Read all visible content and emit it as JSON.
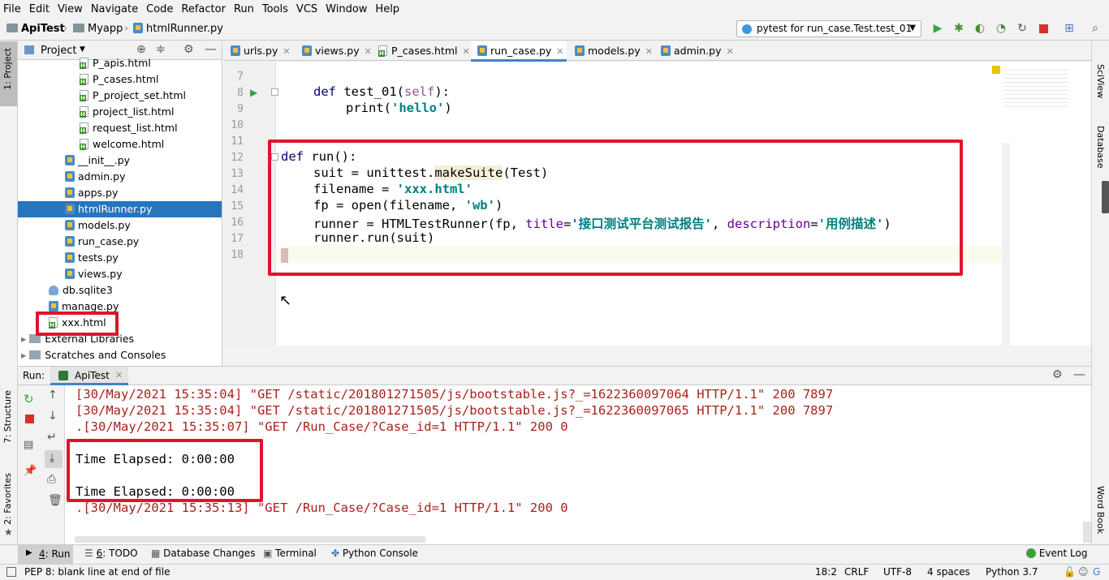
{
  "menu": [
    "File",
    "Edit",
    "View",
    "Navigate",
    "Code",
    "Refactor",
    "Run",
    "Tools",
    "VCS",
    "Window",
    "Help"
  ],
  "breadcrumb": {
    "project": "ApiTest",
    "folder": "Myapp",
    "file": "htmlRunner.py"
  },
  "run_config": "pytest for run_case.Test.test_01",
  "project_panel": {
    "title": "Project",
    "items": [
      {
        "label": "P_apis.html",
        "type": "html",
        "indent": 2
      },
      {
        "label": "P_cases.html",
        "type": "html",
        "indent": 2
      },
      {
        "label": "P_project_set.html",
        "type": "html",
        "indent": 2
      },
      {
        "label": "project_list.html",
        "type": "html",
        "indent": 2
      },
      {
        "label": "request_list.html",
        "type": "html",
        "indent": 2
      },
      {
        "label": "welcome.html",
        "type": "html",
        "indent": 2
      },
      {
        "label": "__init__.py",
        "type": "py",
        "indent": 1
      },
      {
        "label": "admin.py",
        "type": "py",
        "indent": 1
      },
      {
        "label": "apps.py",
        "type": "py",
        "indent": 1
      },
      {
        "label": "htmlRunner.py",
        "type": "py",
        "indent": 1,
        "selected": true
      },
      {
        "label": "models.py",
        "type": "py",
        "indent": 1
      },
      {
        "label": "run_case.py",
        "type": "py",
        "indent": 1
      },
      {
        "label": "tests.py",
        "type": "py",
        "indent": 1
      },
      {
        "label": "views.py",
        "type": "py",
        "indent": 1
      },
      {
        "label": "db.sqlite3",
        "type": "db",
        "indent": 0
      },
      {
        "label": "manage.py",
        "type": "py",
        "indent": 0
      },
      {
        "label": "xxx.html",
        "type": "html",
        "indent": 0
      },
      {
        "label": "External Libraries",
        "type": "lib",
        "indent": -1
      },
      {
        "label": "Scratches and Consoles",
        "type": "lib",
        "indent": -1
      }
    ]
  },
  "tabs": [
    {
      "label": "urls.py"
    },
    {
      "label": "views.py"
    },
    {
      "label": "P_cases.html"
    },
    {
      "label": "run_case.py",
      "active": true
    },
    {
      "label": "models.py"
    },
    {
      "label": "admin.py"
    }
  ],
  "editor": {
    "line_numbers": [
      "7",
      "8",
      "9",
      "10",
      "11",
      "12",
      "13",
      "14",
      "15",
      "16",
      "17",
      "18"
    ],
    "code": {
      "l8_def": "def ",
      "l8_name": "test_01(",
      "l8_self": "self",
      "l8_end": "):",
      "l9_print": "print(",
      "l9_str": "'hello'",
      "l9_end": ")",
      "l12_def": "def ",
      "l12_rest": "run():",
      "l13_a": "suit = unittest.",
      "l13_call": "makeSuite",
      "l13_b": "(Test)",
      "l14_a": "filename = ",
      "l14_str": "'xxx.html'",
      "l15_a": "fp = open(filename, ",
      "l15_str": "'wb'",
      "l15_b": ")",
      "l16_a": "runner = HTMLTestRunner(fp, ",
      "l16_k1": "title",
      "l16_eq1": "=",
      "l16_s1": "'接口测试平台测试报告'",
      "l16_c": ", ",
      "l16_k2": "description",
      "l16_eq2": "=",
      "l16_s2": "'用例描述'",
      "l16_b": ")",
      "l17": "runner.run(suit)"
    }
  },
  "run_panel": {
    "label": "Run:",
    "tab": "ApiTest",
    "lines": [
      {
        "text": "[30/May/2021 15:35:04] \"GET /static/201801271505/js/bootstable.js?_=1622360097064 HTTP/1.1\" 200 7897",
        "kind": "err"
      },
      {
        "text": "[30/May/2021 15:35:04] \"GET /static/201801271505/js/bootstable.js?_=1622360097065 HTTP/1.1\" 200 7897",
        "kind": "err"
      },
      {
        "text": ".[30/May/2021 15:35:07] \"GET /Run_Case/?Case_id=1 HTTP/1.1\" 200 0",
        "kind": "err"
      },
      {
        "text": "",
        "kind": "out"
      },
      {
        "text": "Time Elapsed: 0:00:00",
        "kind": "out"
      },
      {
        "text": "",
        "kind": "out"
      },
      {
        "text": "Time Elapsed: 0:00:00",
        "kind": "out"
      },
      {
        "text": ".[30/May/2021 15:35:13] \"GET /Run_Case/?Case_id=1 HTTP/1.1\" 200 0",
        "kind": "err"
      }
    ]
  },
  "side_tabs": {
    "project": "1: Project",
    "structure": "7: Structure",
    "favorites": "2: Favorites",
    "sciview": "SciView",
    "database": "Database",
    "wordbook": "Word Book"
  },
  "tool_tabs": [
    {
      "num": "4",
      "label": ": Run"
    },
    {
      "num": "6",
      "label": ": TODO"
    },
    {
      "num": "",
      "label": "Database Changes"
    },
    {
      "num": "",
      "label": "Terminal"
    },
    {
      "num": "",
      "label": "Python Console"
    }
  ],
  "event_log": "Event Log",
  "status": {
    "message": "PEP 8: blank line at end of file",
    "position": "18:2",
    "line_sep": "CRLF",
    "encoding": "UTF-8",
    "indent": "4 spaces",
    "interpreter": "Python 3.7"
  },
  "colors": {
    "accent": "#2675bf",
    "highlight_box": "#e0142b",
    "console_err": "#a8221b"
  }
}
